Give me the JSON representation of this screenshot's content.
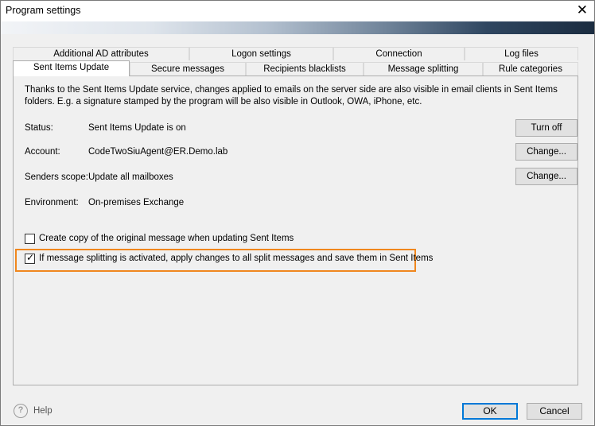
{
  "window": {
    "title": "Program settings"
  },
  "tabs": {
    "row1": [
      "Additional AD attributes",
      "Logon settings",
      "Connection",
      "Log files"
    ],
    "row2": [
      "Sent Items Update",
      "Secure messages",
      "Recipients blacklists",
      "Message splitting",
      "Rule categories"
    ],
    "active": "Sent Items Update"
  },
  "panel": {
    "description": "Thanks to the Sent Items Update service, changes applied to emails on the server side are also visible in email clients in Sent Items folders. E.g. a signature stamped by the program will be also visible in Outlook, OWA, iPhone, etc.",
    "fields": [
      {
        "label": "Status:",
        "value": "Sent Items Update is on",
        "button": "Turn off"
      },
      {
        "label": "Account:",
        "value": "CodeTwoSiuAgent@ER.Demo.lab",
        "button": "Change..."
      },
      {
        "label": "Senders scope:",
        "value": "Update all mailboxes",
        "button": "Change..."
      },
      {
        "label": "Environment:",
        "value": "On-premises Exchange",
        "button": ""
      }
    ],
    "checkboxes": [
      {
        "label": "Create copy of the original message when updating Sent Items",
        "checked": false
      },
      {
        "label": "If message splitting is activated, apply changes to all split messages and save them in Sent Items",
        "checked": true
      }
    ],
    "highlight_color": "#f0871e"
  },
  "footer": {
    "help": "Help",
    "ok": "OK",
    "cancel": "Cancel"
  }
}
